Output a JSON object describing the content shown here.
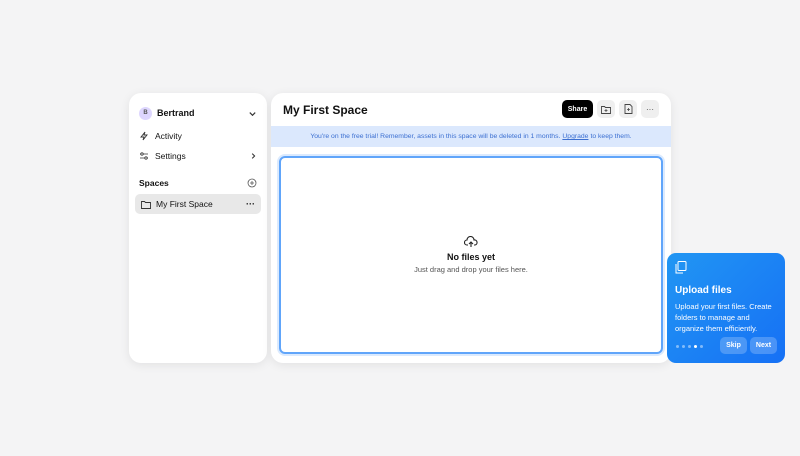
{
  "sidebar": {
    "user": {
      "initial": "B",
      "name": "Bertrand"
    },
    "items": [
      {
        "label": "Activity",
        "icon": "lightning-icon"
      },
      {
        "label": "Settings",
        "icon": "sliders-icon"
      }
    ],
    "spaces_label": "Spaces",
    "spaces": [
      {
        "label": "My First Space"
      }
    ]
  },
  "main": {
    "title": "My First Space",
    "share_label": "Share",
    "banner": {
      "pre": "You're on the free trial! Remember, assets in this space will be deleted in 1 months.",
      "link": "Upgrade",
      "post": "to keep them."
    },
    "empty": {
      "title": "No files yet",
      "subtitle": "Just drag and drop your files here."
    }
  },
  "tour": {
    "title": "Upload files",
    "description": "Upload your first files. Create folders to manage and organize them efficiently.",
    "skip": "Skip",
    "next": "Next",
    "steps": 5,
    "current_step": 4
  },
  "colors": {
    "accent": "#1670f5",
    "banner_bg": "#dbe8fd"
  }
}
